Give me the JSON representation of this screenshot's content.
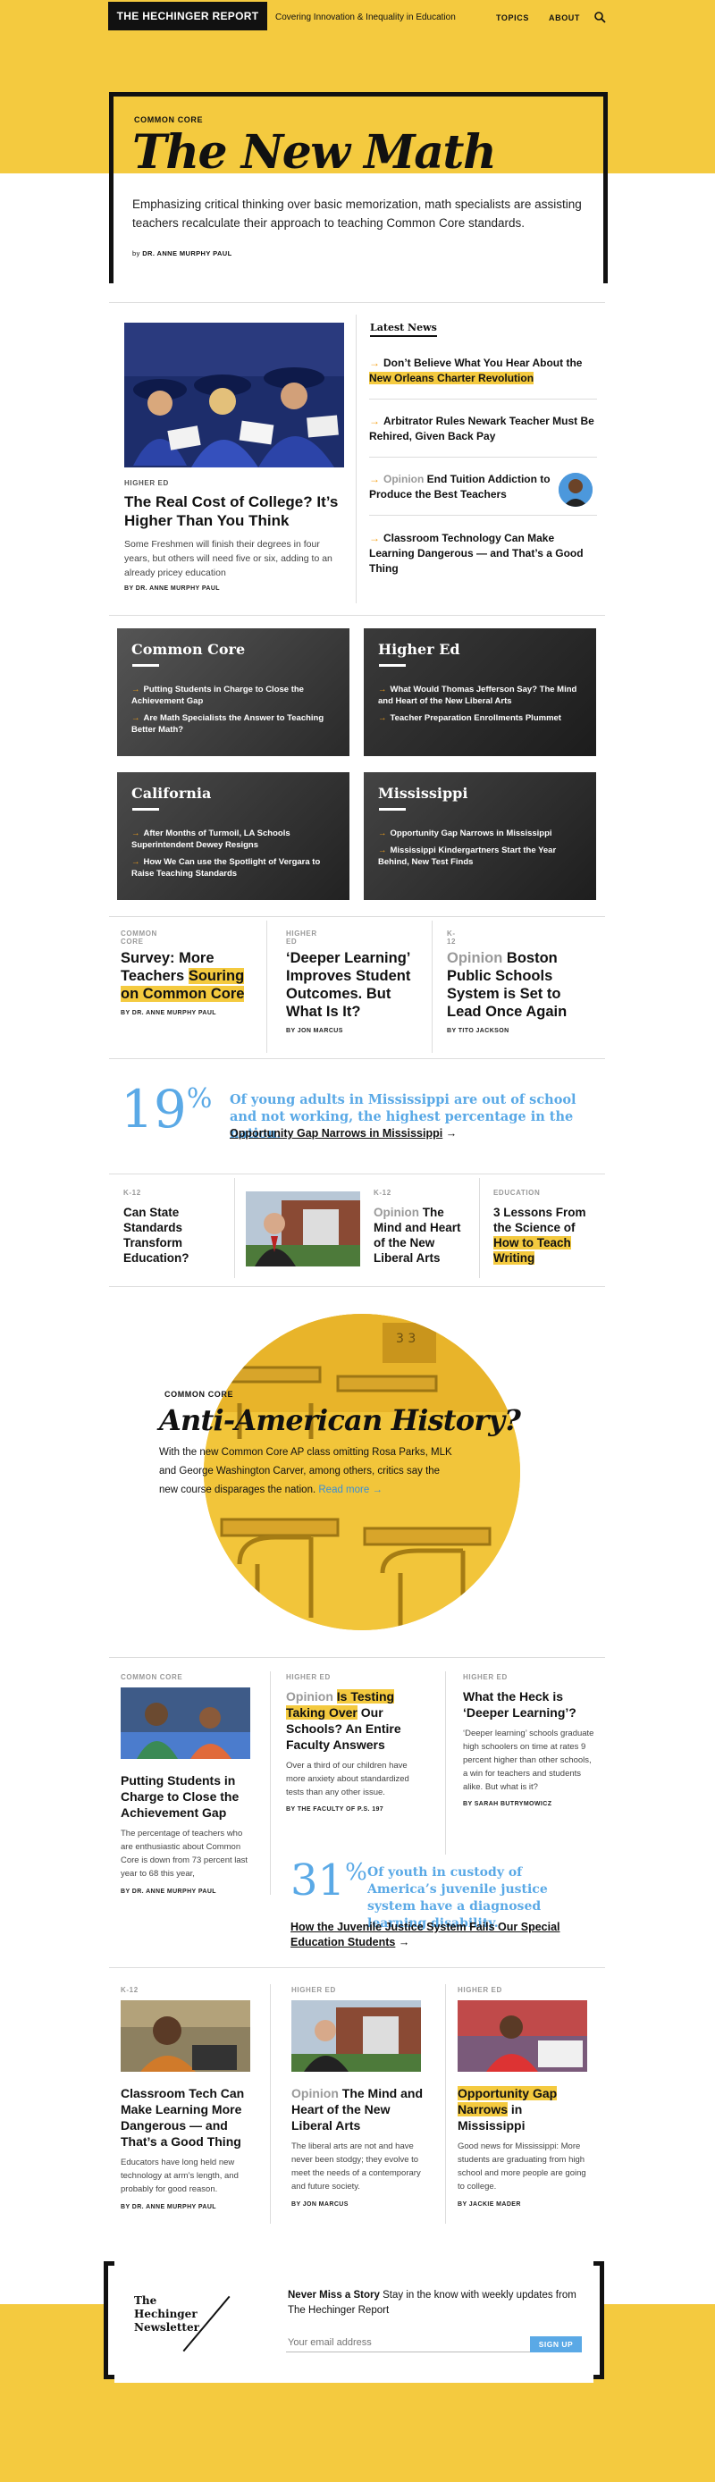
{
  "header": {
    "logo": "THE HECHINGER REPORT",
    "tagline": "Covering Innovation & Inequality in Education",
    "nav": {
      "topics": "TOPICS",
      "about": "ABOUT"
    }
  },
  "hero": {
    "kicker": "COMMON CORE",
    "title": "The New Math",
    "dek": "Emphasizing critical thinking over basic memorization, math specialists are assisting teachers recalculate their approach to teaching Common Core standards.",
    "by": "by",
    "author": "DR. ANNE MURPHY PAUL"
  },
  "feature": {
    "kicker": "HIGHER ED",
    "title": "The Real Cost of College? It’s Higher Than You Think",
    "dek": "Some Freshmen will finish their degrees in four years, but others will need five or six, adding to an already pricey education",
    "byline": "by DR. ANNE MURPHY PAUL"
  },
  "latest": {
    "heading": "Latest News",
    "items": [
      {
        "a": "Don’t Believe What You Hear About the ",
        "hl": "New Orleans Charter Revolution"
      },
      {
        "a": "Arbitrator Rules Newark Teacher Must Be Rehired, Given Back Pay"
      },
      {
        "op": "Opinion",
        "a": " End Tuition Addiction to Produce the Best Teachers"
      },
      {
        "a": "Classroom Technology Can Make Learning Dangerous — and That’s a Good Thing"
      }
    ]
  },
  "tiles": [
    {
      "title": "Common Core",
      "items": [
        "Putting Students in Charge to Close the Achievement Gap",
        "Are Math Specialists the Answer to Teaching Better Math?"
      ]
    },
    {
      "title": "Higher Ed",
      "items": [
        "What Would Thomas Jefferson Say? The Mind and Heart of the New Liberal Arts",
        "Teacher Preparation Enrollments Plummet"
      ]
    },
    {
      "title": "California",
      "items": [
        "After Months of Turmoil, LA Schools Superintendent Dewey Resigns",
        "How We Can use the Spotlight of Vergara to Raise Teaching Standards"
      ]
    },
    {
      "title": "Mississippi",
      "items": [
        "Opportunity Gap Narrows in Mississippi",
        "Mississippi Kindergartners Start the Year Behind, New Test Finds"
      ]
    }
  ],
  "three": [
    {
      "kicker": "COMMON CORE",
      "pre": "Survey: More Teachers ",
      "hl": "Souring on Common Core",
      "by": "by DR. ANNE MURPHY PAUL"
    },
    {
      "kicker": "HIGHER ED",
      "t": "‘Deeper Learning’ Improves Student Outcomes. But What Is It?",
      "by": "by JON MARCUS"
    },
    {
      "kicker": "K-12",
      "op": "Opinion",
      "t": " Boston Public Schools System is Set to Lead Once Again",
      "by": "by TITO JACKSON"
    }
  ],
  "stat1": {
    "num": "19",
    "pct": "%",
    "text": "Of young adults in Mississippi are out of school and not working, the highest percentage in the nation.",
    "link": "Opportunity Gap Narrows in Mississippi",
    "arrow": "→"
  },
  "four": [
    {
      "kicker": "K-12",
      "t": "Can State Standards Transform Education?"
    },
    {
      "kicker": "K-12",
      "op": "Opinion",
      "t": " The Mind and Heart of the New Liberal Arts"
    },
    {
      "kicker": "EDUCATION",
      "t": "3 Lessons From the Science of ",
      "hl": "How to Teach Writing"
    }
  ],
  "circle": {
    "kicker": "COMMON CORE",
    "title": "Anti-American History?",
    "dek": "With the new Common Core AP class omitting Rosa Parks, MLK and George Washington Carver, among others, critics say the new course disparages the nation. ",
    "readmore": "Read more →"
  },
  "lower": {
    "c1": {
      "kicker": "COMMON CORE",
      "t": "Putting Students in Charge to Close the Achievement Gap",
      "d": "The percentage of teachers who are enthusiastic about Common Core is down from 73 percent last year to 68 this year,",
      "by": "by DR. ANNE MURPHY PAUL"
    },
    "c2": {
      "kicker": "HIGHER ED",
      "op": "Opinion",
      "hl1": "Is Testing",
      "hl2": "Taking Over",
      "t": " Our Schools? An Entire Faculty Answers",
      "d": "Over a third of our children have more anxiety about standardized tests than any other issue.",
      "by": "by THE FACULTY OF P.S. 197"
    },
    "c3": {
      "kicker": "HIGHER ED",
      "t": "What the Heck is ‘Deeper Learning’?",
      "d": "‘Deeper learning’ schools graduate high schoolers on time at rates 9 percent higher than other schools, a win for teachers and students alike. But what is it?",
      "by": "by SARAH BUTRYMOWICZ"
    }
  },
  "stat2": {
    "num": "31",
    "pct": "%",
    "text": "Of youth in custody of America’s juvenile justice system have a diagnosed learning disability.",
    "link": "How the Juvenile Justice System Fails Our Special Education Students",
    "arrow": "→"
  },
  "bottom": {
    "c1": {
      "kicker": "K-12",
      "t": "Classroom Tech Can Make Learning More Dangerous — and That’s a Good Thing",
      "d": "Educators have long held new technology at arm’s length, and probably for good reason.",
      "by": "by DR. ANNE MURPHY PAUL"
    },
    "c2": {
      "kicker": "HIGHER ED",
      "op": "Opinion",
      "t": " The Mind and Heart of the New Liberal Arts",
      "d": "The liberal arts are not and have never been stodgy; they evolve to meet the needs of a contemporary and future society.",
      "by": "by JON MARCUS"
    },
    "c3": {
      "kicker": "HIGHER ED",
      "hl": "Opportunity Gap Narrows",
      "t": " in Mississippi",
      "d": "Good news for Mississippi: More students are graduating from high school and more people are going to college.",
      "by": "by JACKIE MADER"
    }
  },
  "newsletter": {
    "name": "The Hechinger Newsletter",
    "headline_bold": "Never Miss a Story",
    "headline": " Stay in the know with weekly updates from The Hechinger Report",
    "placeholder": "Your email address",
    "button": "SIGN UP"
  },
  "colors": {
    "brand_yellow": "#f4ca3f",
    "accent_blue": "#5aa9e6",
    "arrow_orange": "#f4a21a"
  }
}
